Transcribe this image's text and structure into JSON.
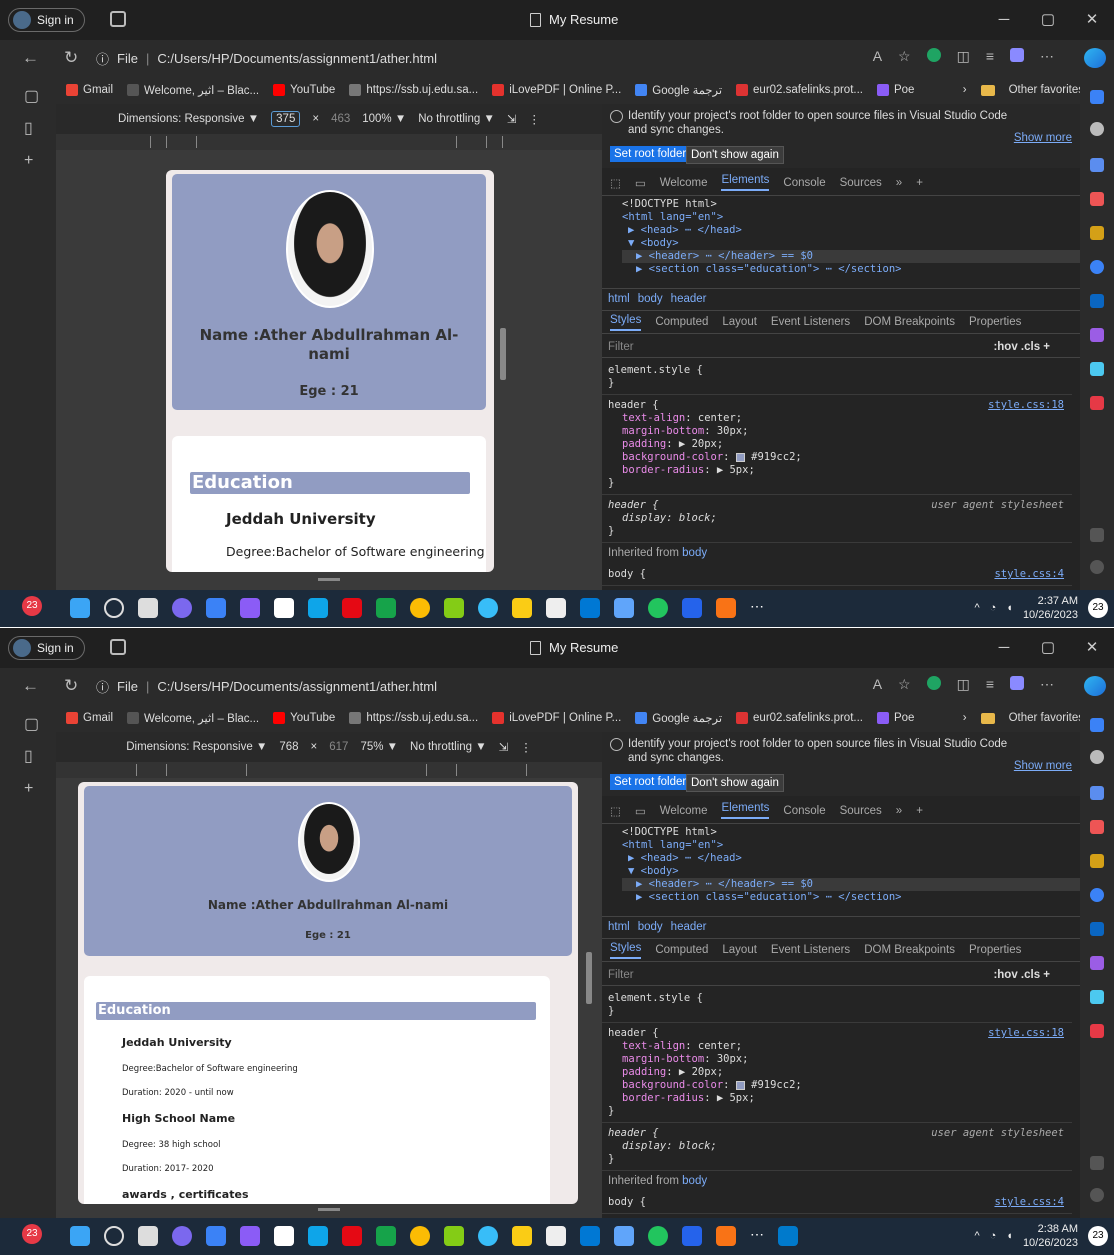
{
  "browser": {
    "sign_in": "Sign in",
    "window_title": "My Resume",
    "url_prefix": "File",
    "url": "C:/Users/HP/Documents/assignment1/ather.html",
    "favorites": [
      "Gmail",
      "Welcome, اثير – Blac...",
      "YouTube",
      "https://ssb.uj.edu.sa...",
      "iLovePDF | Online P...",
      "Google ترجمة",
      "eur02.safelinks.prot...",
      "Poe"
    ],
    "other_favorites": "Other favorites"
  },
  "devtools": {
    "notice": "Identify your project's root folder to open source files in Visual Studio Code and sync changes.",
    "show_more": "Show more",
    "set_root": "Set root folder",
    "dont_show": "Don't show again",
    "tabs": [
      "Welcome",
      "Elements",
      "Console",
      "Sources"
    ],
    "dom_lines": [
      "<!DOCTYPE html>",
      "<html lang=\"en\">",
      "▶ <head> ⋯ </head>",
      "▼ <body>",
      "▶ <header> ⋯ </header> == $0",
      "▶ <section class=\"education\"> ⋯ </section>"
    ],
    "breadcrumbs": [
      "html",
      "body",
      "header"
    ],
    "style_tabs": [
      "Styles",
      "Computed",
      "Layout",
      "Event Listeners",
      "DOM Breakpoints",
      "Properties"
    ],
    "filter_placeholder": "Filter",
    "filter_right": ":hov  .cls  +",
    "element_style": "element.style {",
    "header_source": "style.css:18",
    "header_props": [
      {
        "name": "text-align",
        "value": "center;"
      },
      {
        "name": "margin-bottom",
        "value": "30px;"
      },
      {
        "name": "padding",
        "value": "▶ 20px;"
      },
      {
        "name": "background-color",
        "value": "#919cc2;"
      },
      {
        "name": "border-radius",
        "value": "▶ 5px;"
      }
    ],
    "ua_label": "user agent stylesheet",
    "ua_prop": "display: block;",
    "inherited": "Inherited from",
    "inherited_from": "body",
    "body_source": "style.css:4"
  },
  "colors": {
    "header_bg": "#919cc2",
    "accent": "#7cacf8"
  },
  "shots": [
    {
      "dims_label": "Dimensions: Responsive ▼",
      "width": "375",
      "height": "463",
      "zoom": "100% ▼",
      "throttle": "No throttling ▼",
      "time": "2:37 AM",
      "date": "10/26/2023"
    },
    {
      "dims_label": "Dimensions: Responsive ▼",
      "width": "768",
      "height": "617",
      "zoom": "75% ▼",
      "throttle": "No throttling ▼",
      "time": "2:38 AM",
      "date": "10/26/2023"
    }
  ],
  "resume": {
    "name": "Name :Ather Abdullrahman Al-nami",
    "name_wrap_1": "Name :Ather Abdullrahman Al-",
    "name_wrap_2": "nami",
    "age": "Ege : 21",
    "education_title": "Education",
    "university": "Jeddah University",
    "degree": "Degree:Bachelor of Software engineering",
    "duration": "Duration: 2020 - until now",
    "school": "High School Name",
    "school_degree": "Degree: 38 high school",
    "school_duration": "Duration: 2017- 2020",
    "awards": "awards , certificates"
  },
  "taskbar": {
    "notif": "23",
    "mail_badge": "9",
    "wa_badge": "24"
  }
}
